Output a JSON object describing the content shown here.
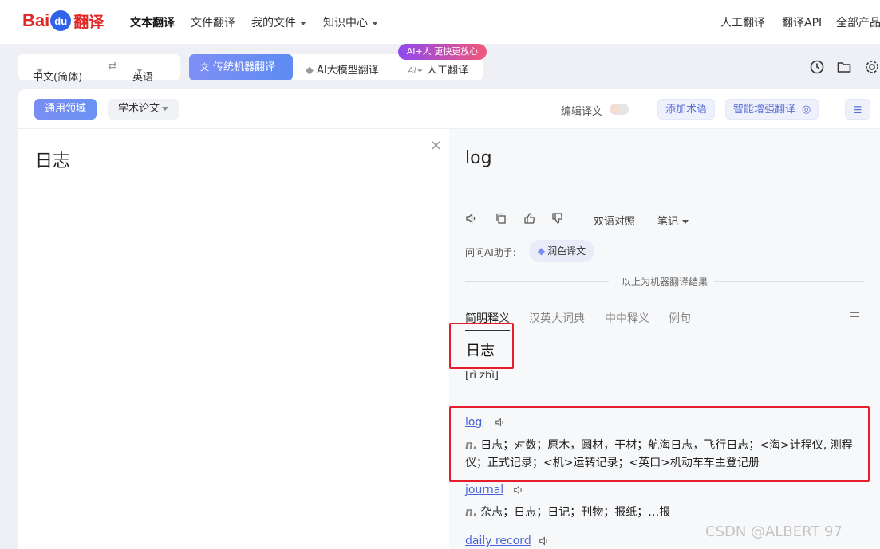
{
  "logo": {
    "bai": "Bai",
    "du": "du",
    "fy": "翻译"
  },
  "nav": {
    "text_translate": "文本翻译",
    "file_translate": "文件翻译",
    "my_files": "我的文件",
    "knowledge": "知识中心",
    "human_translate": "人工翻译",
    "api": "翻译API",
    "all_products": "全部产品"
  },
  "lang": {
    "source": "中文(简体)",
    "target": "英语"
  },
  "modes": {
    "traditional": "传统机器翻译",
    "ai_model": "AI大模型翻译",
    "human": "人工翻译",
    "ai_tag": "AI+人 更快更放心"
  },
  "domain": {
    "general": "通用领域",
    "academic": "学术论文"
  },
  "header_tools": {
    "edit_translation": "编辑译文",
    "add_terms": "添加术语",
    "smart_enhance": "智能增强翻译"
  },
  "source": {
    "text": "日志",
    "clear": "×"
  },
  "result": {
    "text": "log",
    "bilingual": "双语对照",
    "notes": "笔记",
    "ai_assistant": "问问AI助手:",
    "polish": "润色译文",
    "machine_note": "以上为机器翻译结果"
  },
  "dict": {
    "tabs": [
      "简明释义",
      "汉英大词典",
      "中中释义",
      "例句"
    ],
    "word": "日志",
    "pinyin": "[rì zhì]",
    "entries": [
      {
        "word": "log",
        "pos": "n.",
        "def": "日志；对数；原木，圆材，干材；航海日志，飞行日志；<海>计程仪, 测程仪；正式记录；<机>运转记录；<英口>机动车车主登记册"
      },
      {
        "word": "journal",
        "pos": "n.",
        "def": "杂志；日志；日记；刊物；报纸；…报"
      },
      {
        "word": "daily record"
      }
    ]
  },
  "watermark": "CSDN @ALBERT 97",
  "colors": {
    "brand_red": "#e12826",
    "brand_blue": "#2f63e8",
    "accent": "#6a8cf4",
    "highlight_box": "#e41e2a",
    "link": "#4a64d8"
  }
}
